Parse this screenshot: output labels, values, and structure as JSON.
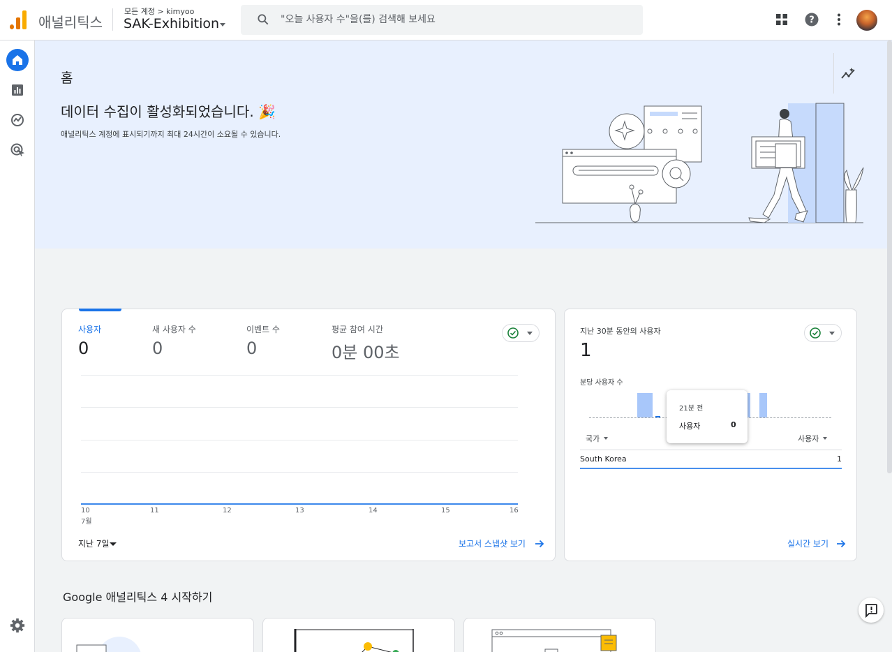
{
  "header": {
    "brand": "애널리틱스",
    "breadcrumb": "모든 계정 > kimyoo",
    "account_name": "SAK-Exhibition",
    "search_placeholder": "\"오늘 사용자 수\"을(를) 검색해 보세요",
    "icons": [
      "apps-grid-icon",
      "help-icon",
      "more-vert-icon",
      "avatar"
    ]
  },
  "leftnav": {
    "items": [
      "home-icon",
      "reports-icon",
      "explore-icon",
      "advertising-icon"
    ],
    "bottom": "settings-icon"
  },
  "hero": {
    "page_title": "홈",
    "headline": "데이터 수집이 활성화되었습니다. 🎉",
    "subtext": "애널리틱스 계정에 표시되기까지 최대 24시간이 소요될 수 있습니다."
  },
  "overview_card": {
    "metrics": [
      {
        "label": "사용자",
        "value": "0"
      },
      {
        "label": "새 사용자 수",
        "value": "0"
      },
      {
        "label": "이벤트 수",
        "value": "0"
      },
      {
        "label": "평균 참여 시간",
        "value": "0분 00초"
      }
    ],
    "x_ticks": [
      "10",
      "11",
      "12",
      "13",
      "14",
      "15",
      "16"
    ],
    "x_month": "7월",
    "date_range": "지난 7일",
    "link": "보고서 스냅샷 보기"
  },
  "realtime_card": {
    "title": "지난 30분 동안의 사용자",
    "value": "1",
    "subtitle": "분당 사용자 수",
    "tooltip": {
      "time": "21분 전",
      "label": "사용자",
      "value": "0"
    },
    "col_country": "국가",
    "col_users": "사용자",
    "rows": [
      {
        "country": "South Korea",
        "users": "1"
      }
    ],
    "link": "실시간 보기"
  },
  "getting_started": {
    "title": "Google 애널리틱스 4 시작하기"
  },
  "chart_data": {
    "type": "line",
    "categories": [
      "10",
      "11",
      "12",
      "13",
      "14",
      "15",
      "16"
    ],
    "series": [
      {
        "name": "사용자",
        "values": [
          0,
          0,
          0,
          0,
          0,
          0,
          0
        ]
      }
    ],
    "xlabel": "7월",
    "ylabel": ""
  },
  "colors": {
    "accent": "#1a73e8",
    "hero_bg": "#e8f0fe",
    "bar": "#a8c7fa",
    "success": "#188038"
  }
}
